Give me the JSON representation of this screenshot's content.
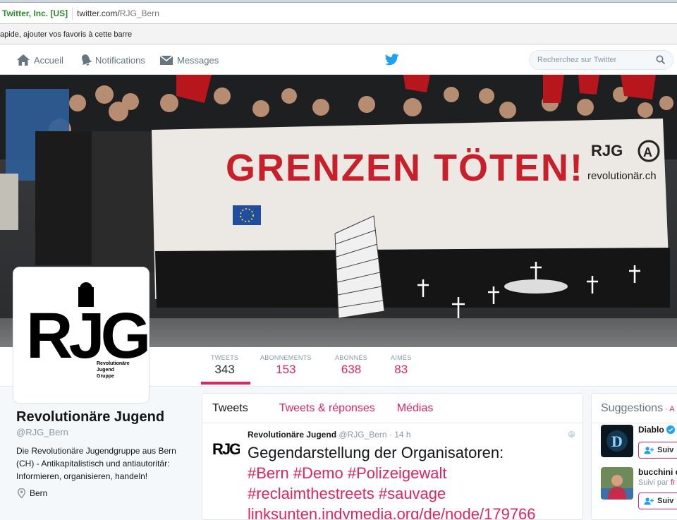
{
  "browser": {
    "site_identity": "Twitter, Inc. [US]",
    "url_host": "twitter.com/",
    "url_path": "RJG_Bern",
    "bookmarks_hint": "apide, ajouter vos favoris à cette barre"
  },
  "nav": {
    "home": "Accueil",
    "notifications": "Notifications",
    "messages": "Messages",
    "search_placeholder": "Recherchez sur Twitter"
  },
  "banner": {
    "text": "GRENZEN TÖTEN!",
    "logo_text": "RJG",
    "site": "revolutionär.ch"
  },
  "avatar": {
    "logo": "RJG",
    "subtitle_lines": [
      "Revolutionäre",
      "Jugend",
      "Gruppe"
    ]
  },
  "stats": [
    {
      "label": "TWEETS",
      "value": "343"
    },
    {
      "label": "ABONNEMENTS",
      "value": "153"
    },
    {
      "label": "ABONNÉS",
      "value": "638"
    },
    {
      "label": "AIMÉS",
      "value": "83"
    }
  ],
  "profile": {
    "name": "Revolutionäre Jugend",
    "handle": "@RJG_Bern",
    "bio": "Die Revolutionäre Jugendgruppe aus Bern (CH) - Antikapitalistisch und antiautoritär: Informieren, organisieren, handeln!",
    "location": "Bern"
  },
  "timeline": {
    "tabs": [
      "Tweets",
      "Tweets & réponses",
      "Médias"
    ],
    "tweet": {
      "author": "Revolutionäre Jugend",
      "handle": "@RJG_Bern",
      "separator": " · ",
      "time": "14 h",
      "text_plain": "Gegendarstellung der Organisatoren:",
      "hashtags_line1": "#Bern #Demo #Polizeigewalt",
      "hashtags_line2": "#reclaimthestreets #sauvage",
      "link": "linksunten.indymedia.org/de/node/179766"
    }
  },
  "suggestions": {
    "title": "Suggestions",
    "refresh": " · A",
    "items": [
      {
        "name": "Diablo",
        "sub": "",
        "button": "Suiv"
      },
      {
        "name": "bucchini c",
        "sub_prefix": "Suivi par ",
        "sub_link": "fr",
        "button": "Suiv"
      }
    ]
  },
  "colors": {
    "accent": "#e0245e",
    "twitter_blue": "#1da1f2"
  }
}
